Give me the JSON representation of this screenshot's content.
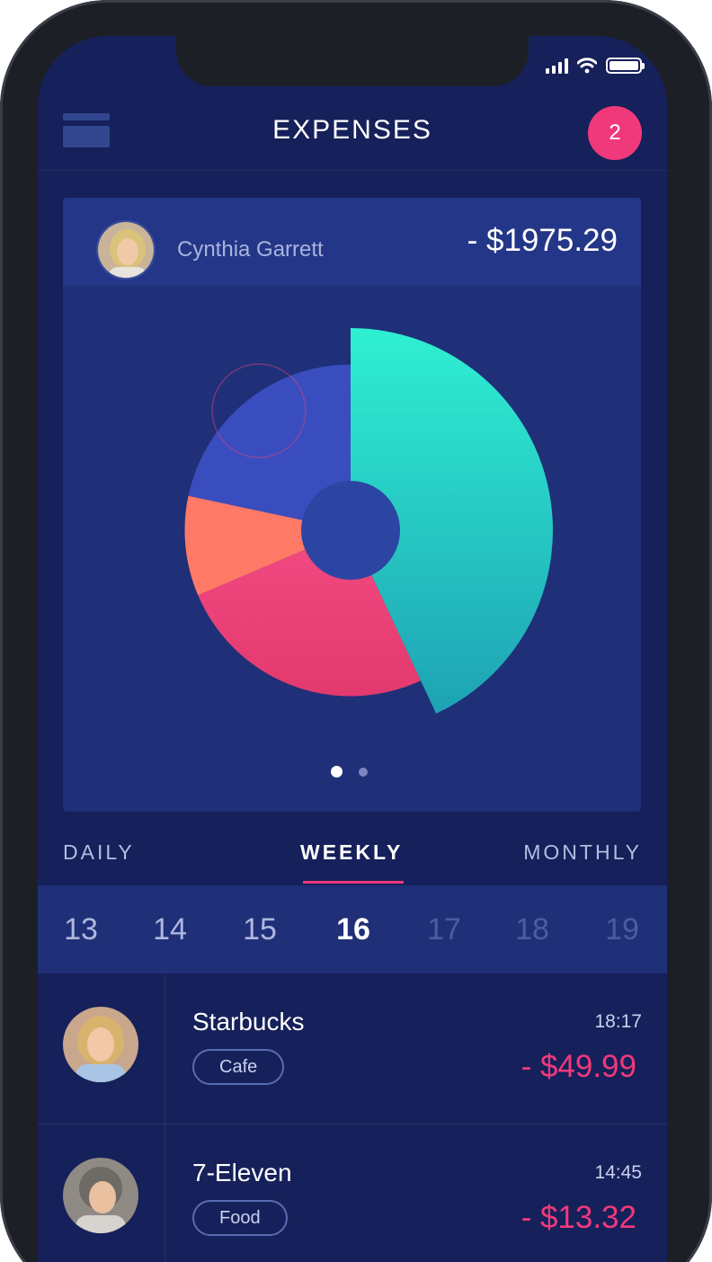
{
  "header": {
    "title": "EXPENSES",
    "badge_count": "2"
  },
  "summary": {
    "user_name": "Cynthia Garrett",
    "amount": "- $1975.29"
  },
  "chart_data": {
    "type": "pie",
    "style": "rose",
    "center_hole": true,
    "slices": [
      {
        "start_deg": 0,
        "end_deg": 155,
        "radius": 1.0,
        "color_top": "#2ff0d2",
        "color_bottom": "#1ea2b4"
      },
      {
        "start_deg": 155,
        "end_deg": 247,
        "radius": 0.82,
        "color_top": "#f24a82",
        "color_bottom": "#e23a6e"
      },
      {
        "start_deg": 247,
        "end_deg": 282,
        "radius": 0.82,
        "color_top": "#ff7a66",
        "color_bottom": "#ff7a66"
      },
      {
        "start_deg": 282,
        "end_deg": 360,
        "radius": 0.82,
        "color_top": "#3a4dbe",
        "color_bottom": "#3a4dbe"
      }
    ],
    "page_indicator": {
      "pages": 2,
      "active": 1
    }
  },
  "period_tabs": [
    {
      "label": "DAILY",
      "active": false
    },
    {
      "label": "WEEKLY",
      "active": true
    },
    {
      "label": "MONTHLY",
      "active": false
    }
  ],
  "days": [
    {
      "label": "13",
      "state": "past"
    },
    {
      "label": "14",
      "state": "past"
    },
    {
      "label": "15",
      "state": "past"
    },
    {
      "label": "16",
      "state": "selected"
    },
    {
      "label": "17",
      "state": "future"
    },
    {
      "label": "18",
      "state": "future"
    },
    {
      "label": "19",
      "state": "future"
    }
  ],
  "transactions": [
    {
      "merchant": "Starbucks",
      "category": "Cafe",
      "time": "18:17",
      "amount": "- $49.99"
    },
    {
      "merchant": "7-Eleven",
      "category": "Food",
      "time": "14:45",
      "amount": "- $13.32"
    }
  ],
  "colors": {
    "accent": "#f0397a",
    "screen_bg": "#16205a",
    "card_bg": "#1f2f78"
  }
}
